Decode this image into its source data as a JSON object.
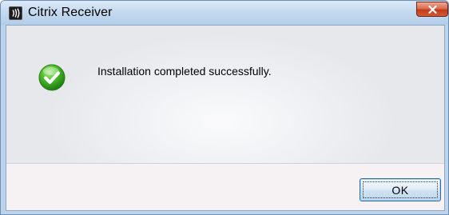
{
  "window": {
    "title": "Citrix Receiver",
    "app_icon": "citrix-receiver-icon",
    "close_icon": "close-icon"
  },
  "dialog": {
    "status_icon": "success-check-icon",
    "message": "Installation completed successfully.",
    "ok_label": "OK"
  },
  "colors": {
    "titlebar": "#c5daf0",
    "close_button": "#c7472a",
    "success_green": "#3aa51f",
    "ok_border": "#2b6c9c"
  }
}
